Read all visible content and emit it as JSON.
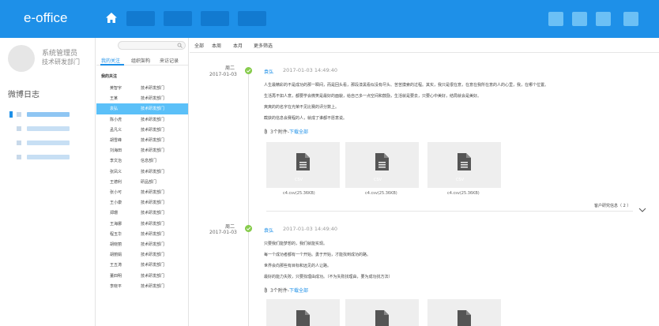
{
  "app": {
    "title": "e-office"
  },
  "user": {
    "name": "系统管理员",
    "dept": "技术研发部门"
  },
  "sidebar": {
    "section_title": "微博日志"
  },
  "search": {
    "placeholder": ""
  },
  "contacts": {
    "tabs": [
      "我的关注",
      "组织架构",
      "来访记录"
    ],
    "group_label": "我的关注",
    "rows": [
      {
        "name": "黄智宇",
        "dept": "技术研发部门"
      },
      {
        "name": "王某",
        "dept": "技术研发部门"
      },
      {
        "name": "袁弘",
        "dept": "技术研发部门"
      },
      {
        "name": "陈小虎",
        "dept": "技术研发部门"
      },
      {
        "name": "孟凡义",
        "dept": "技术研发部门"
      },
      {
        "name": "胡雪峰",
        "dept": "技术研发部门"
      },
      {
        "name": "刘海田",
        "dept": "技术研发部门"
      },
      {
        "name": "李文治",
        "dept": "信息部门"
      },
      {
        "name": "张凤义",
        "dept": "技术研发部门"
      },
      {
        "name": "王德利",
        "dept": "研品部门"
      },
      {
        "name": "张小可",
        "dept": "技术研发部门"
      },
      {
        "name": "王小康",
        "dept": "技术研发部门"
      },
      {
        "name": "郑珊",
        "dept": "技术研发部门"
      },
      {
        "name": "王海娜",
        "dept": "技术研发部门"
      },
      {
        "name": "程玉华",
        "dept": "技术研发部门"
      },
      {
        "name": "胡晓丽",
        "dept": "技术研发部门"
      },
      {
        "name": "胡丽娟",
        "dept": "技术研发部门"
      },
      {
        "name": "王五涛",
        "dept": "技术研发部门"
      },
      {
        "name": "董四明",
        "dept": "技术研发部门"
      },
      {
        "name": "李晓平",
        "dept": "技术研发部门"
      }
    ]
  },
  "filters": [
    "全部",
    "本周",
    "本月",
    "更多筛选"
  ],
  "posts": [
    {
      "weekday": "周二",
      "date": "2017-01-03",
      "author": "袁弘",
      "time": "2017-01-03   14:49:40",
      "paragraphs": [
        "人生最精彩的不是成功的那一瞬间，而是回头看，那段漆黑看似没有尽头、苦苦摸索的过程。其实，我只是很在意，在意在我所在意的人的心里，我，在哪个位置。",
        "生活再不如人意，都要学会微笑是最好的面貌，给自己多一点空间和鼓励，生活就是要去，只要心中美好，结局就会是美好。",
        "爽爽的的名字在光荣不见比赛的评分数上。",
        "截获的信息会赛程的人，就成了谁都不愿意说。"
      ],
      "attach_count": "3个附件-",
      "attach_link": "下载全部",
      "files": [
        {
          "ext": "CSV",
          "caption": "c4.csv(25.36KB)"
        },
        {
          "ext": "CSV",
          "caption": "c4.csv(25.36KB)"
        },
        {
          "ext": "CSV",
          "caption": "c4.csv(25.36KB)"
        }
      ],
      "reply": "客户研究信息（ 2 ）"
    },
    {
      "weekday": "周二",
      "date": "2017-01-03",
      "author": "袁弘",
      "time": "2017-01-03   14:49:40",
      "paragraphs": [
        "只要我们能梦想的，我们就能实现。",
        "每一个成功者都有一个开始。勇于开始，才能找到成功的路。",
        "世界会向那些有目标和远见的人让路。",
        "最好的能力失败，只要找理由成功。（不为失败找理由，要为成功找方法）"
      ],
      "attach_count": "3个附件-",
      "attach_link": "下载全部",
      "files": [
        {
          "ext": "",
          "caption": ""
        },
        {
          "ext": "",
          "caption": ""
        },
        {
          "ext": "",
          "caption": ""
        }
      ]
    }
  ],
  "colors": {
    "topbar": "#1e90e8",
    "selected_row": "#5bc0f8",
    "check": "#88cc4e",
    "link": "#1e90e8"
  },
  "icons": [
    "home-icon",
    "search-icon",
    "paperclip-icon",
    "file-icon",
    "check-icon",
    "chevron-down-icon"
  ]
}
